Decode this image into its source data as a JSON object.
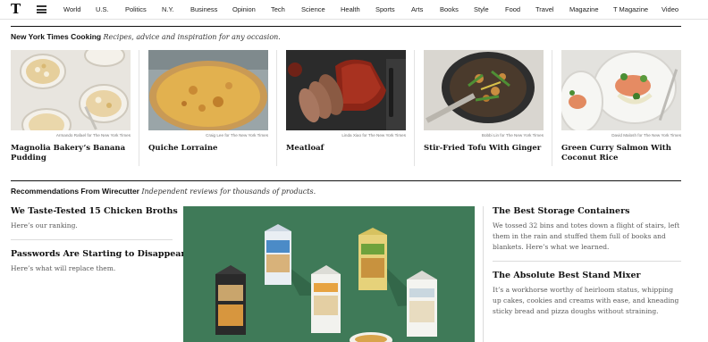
{
  "nav": {
    "logo": "T",
    "sections": [
      "World",
      "U.S.",
      "Politics",
      "N.Y.",
      "Business",
      "Opinion",
      "Tech",
      "Science",
      "Health",
      "Sports",
      "Arts",
      "Books",
      "Style",
      "Food",
      "Travel",
      "Magazine",
      "T Magazine",
      "Video"
    ]
  },
  "cooking": {
    "heading": "New York Times Cooking",
    "tagline": "Recipes, advice and inspiration for any occasion.",
    "cards": [
      {
        "title": "Magnolia Bakery’s Banana Pudding",
        "credit": "Armando Rafael for The New York Times"
      },
      {
        "title": "Quiche Lorraine",
        "credit": "Craig Lee for The New York Times"
      },
      {
        "title": "Meatloaf",
        "credit": "Linda Xiao for The New York Times"
      },
      {
        "title": "Stir-Fried Tofu With Ginger",
        "credit": "Bobbi Lin for The New York Times"
      },
      {
        "title": "Green Curry Salmon With Coconut Rice",
        "credit": "David Malosh for The New York Times"
      }
    ]
  },
  "wirecutter": {
    "heading": "Recommendations From Wirecutter",
    "tagline": "Independent reviews for thousands of products.",
    "left": [
      {
        "title": "We Taste-Tested 15 Chicken Broths",
        "summary": "Here’s our ranking."
      },
      {
        "title": "Passwords Are Starting to Disappear",
        "summary": "Here’s what will replace them."
      }
    ],
    "right": [
      {
        "title": "The Best Storage Containers",
        "summary": "We tossed 32 bins and totes down a flight of stairs, left them in the rain and stuffed them full of books and blankets. Here’s what we learned."
      },
      {
        "title": "The Absolute Best Stand Mixer",
        "summary": "It’s a workhorse worthy of heirloom status, whipping up cakes, cookies and creams with ease, and kneading sticky bread and pizza doughs without straining."
      }
    ]
  },
  "colors": {
    "hero_green": "#3f7a58",
    "rule": "#121212",
    "divider": "#e2e2e2"
  }
}
